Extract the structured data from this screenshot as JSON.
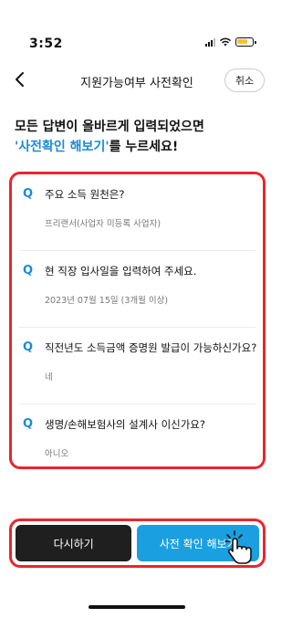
{
  "status_bar": {
    "time": "3:52",
    "icons": [
      "signal-icon",
      "wifi-icon",
      "battery-icon"
    ],
    "battery_color": "#f4c430"
  },
  "nav": {
    "back_icon": "chevron-left-icon",
    "title": "지원가능여부 사전확인",
    "cancel_label": "취소"
  },
  "intro": {
    "line1": "모든 답변이 올바르게 입력되었으면",
    "highlight": "'사전확인 해보기'",
    "line2_suffix": "를 누르세요!",
    "highlight_color": "#1a8bd6"
  },
  "questions": [
    {
      "mark": "Q",
      "question": "주요 소득 원천은?",
      "answer": "프리랜서(사업자 미등록 사업자)"
    },
    {
      "mark": "Q",
      "question": "현 직장 입사일을 입력하여 주세요.",
      "answer": "2023년 07월 15일 (3개월 이상)"
    },
    {
      "mark": "Q",
      "question": "직전년도 소득금액 증명원 발급이 가능하신가요?",
      "answer": "네"
    },
    {
      "mark": "Q",
      "question": "생명/손해보험사의 설계사 이신가요?",
      "answer": "아니오"
    }
  ],
  "actions": {
    "retry_label": "다시하기",
    "check_label": "사전 확인 해보기",
    "retry_color": "#1f1f1f",
    "check_color": "#1aa0e0",
    "pointer_icon": "hand-pointer-icon"
  },
  "annotation_color": "#e8262f"
}
